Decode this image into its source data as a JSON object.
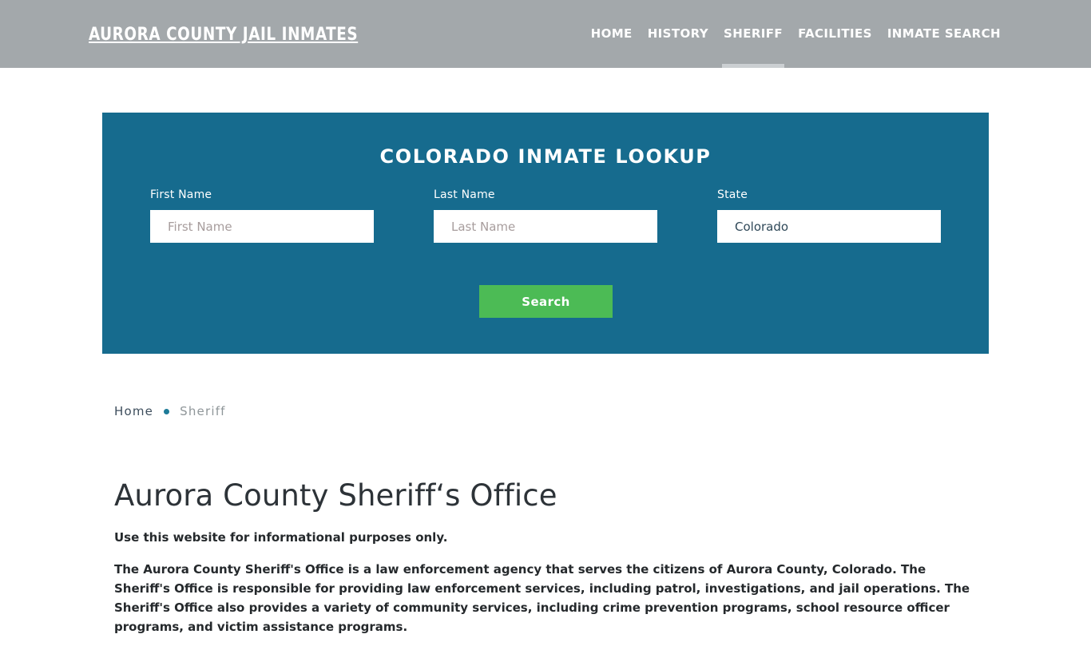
{
  "header": {
    "brand": "AURORA COUNTY JAIL INMATES",
    "nav": [
      {
        "label": "HOME",
        "active": false
      },
      {
        "label": "HISTORY",
        "active": false
      },
      {
        "label": "SHERIFF",
        "active": true
      },
      {
        "label": "FACILITIES",
        "active": false
      },
      {
        "label": "INMATE SEARCH",
        "active": false
      }
    ],
    "background_color": "#a3a8ab",
    "active_indicator_color": "#cbcfd2"
  },
  "lookup": {
    "title": "COLORADO INMATE LOOKUP",
    "panel_color": "#166b8e",
    "fields": {
      "first_name": {
        "label": "First Name",
        "placeholder": "First Name",
        "value": ""
      },
      "last_name": {
        "label": "Last Name",
        "placeholder": "Last Name",
        "value": ""
      },
      "state": {
        "label": "State",
        "placeholder": "State",
        "value": "Colorado"
      }
    },
    "search_label": "Search",
    "search_color": "#4cbb55"
  },
  "breadcrumb": {
    "home": "Home",
    "separator": "•",
    "current": "Sheriff",
    "separator_color": "#1e7b98"
  },
  "main": {
    "title": "Aurora County Sheriff‘s Office",
    "lede": "Use this website for informational purposes only.",
    "paragraph": "The Aurora County Sheriff's Office is a law enforcement agency that serves the citizens of Aurora County, Colorado. The Sheriff's Office is responsible for providing law enforcement services, including patrol, investigations, and jail operations. The Sheriff's Office also provides a variety of community services, including crime prevention programs, school resource officer programs, and victim assistance programs.",
    "paragraph_next": ""
  }
}
